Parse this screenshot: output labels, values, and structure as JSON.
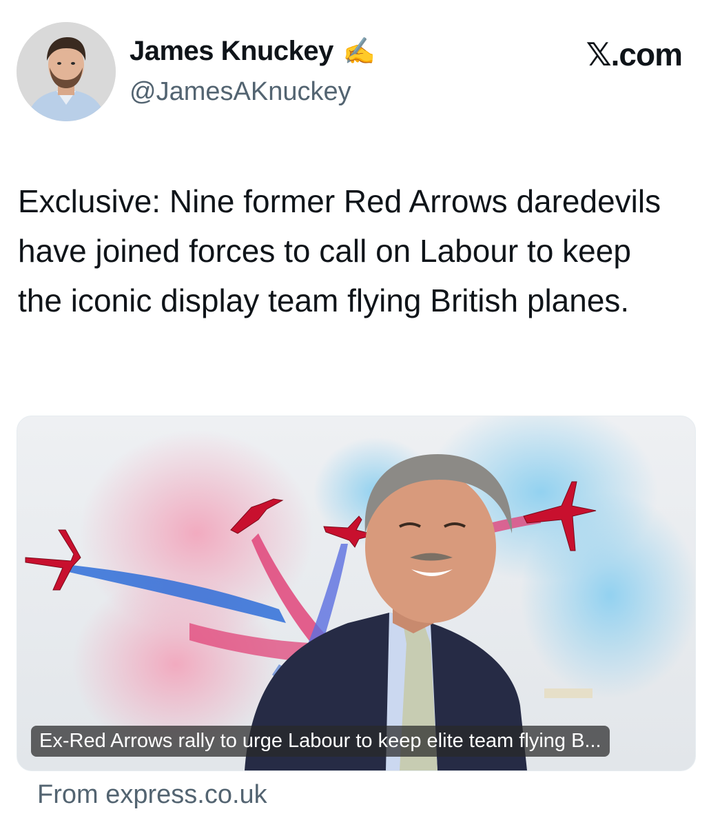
{
  "author": {
    "name": "James Knuckey",
    "emoji": "✍️",
    "handle": "@JamesAKnuckey"
  },
  "site_badge": {
    "mark": "𝕏",
    "suffix": ".com"
  },
  "tweet": {
    "text": "Exclusive: Nine former Red Arrows daredevils have joined forces to call on Labour to keep the iconic display team flying British planes."
  },
  "link_card": {
    "caption": "Ex-Red Arrows rally to urge Labour to keep elite team flying B...",
    "source": "From express.co.uk"
  },
  "colors": {
    "text_primary": "#0f1419",
    "text_secondary": "#536471",
    "smoke_red": "#e8557f",
    "smoke_blue": "#2f7fe0",
    "jet_red": "#c8102e"
  }
}
